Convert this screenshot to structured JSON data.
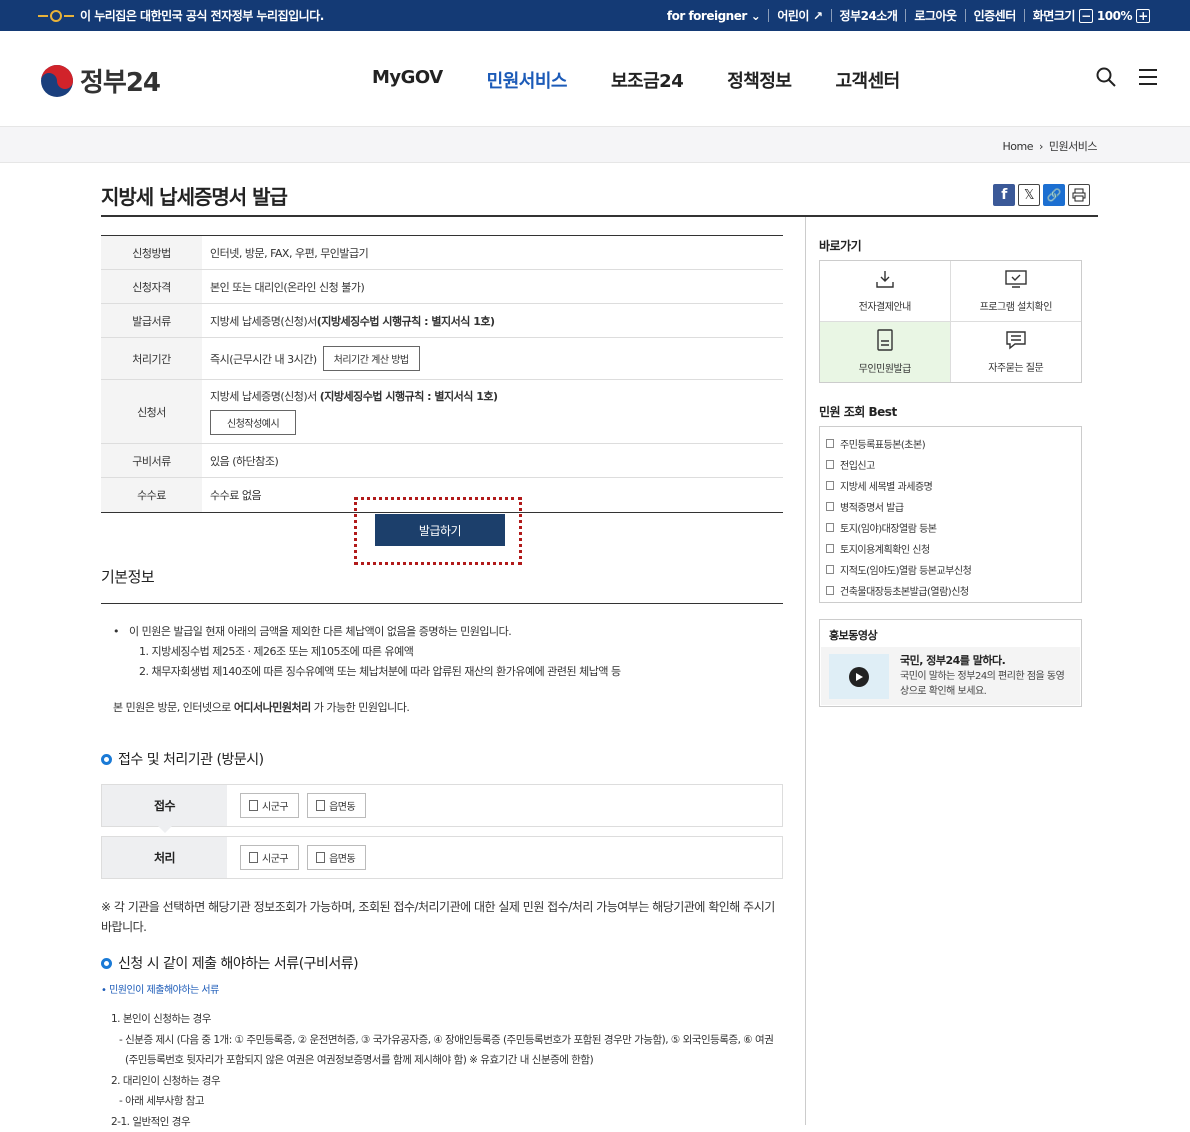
{
  "govbar": {
    "notice": "이 누리집은 대한민국 공식 전자정부 누리집입니다.",
    "links": [
      "for foreigner",
      "어린이",
      "정부24소개",
      "로그아웃",
      "인증센터"
    ],
    "zoom_label": "화면크기",
    "zoom_value": "100%"
  },
  "header": {
    "logo_text": "정부24",
    "nav": [
      "MyGOV",
      "민원서비스",
      "보조금24",
      "정책정보",
      "고객센터"
    ],
    "active_nav": "민원서비스"
  },
  "breadcrumb": [
    "Home",
    "민원서비스"
  ],
  "page": {
    "title": "지방세 납세증명서 발급",
    "info_rows": [
      {
        "label": "신청방법",
        "value": "인터넷, 방문, FAX, 우편, 무인발급기"
      },
      {
        "label": "신청자격",
        "value": "본인 또는 대리인(온라인 신청 불가)"
      },
      {
        "label": "발급서류",
        "value": "지방세 납세증명(신청)서 ",
        "bold": "(지방세징수법 시행규칙 : 별지서식 1호)"
      },
      {
        "label": "처리기간",
        "value": "즉시(근무시간 내 3시간)",
        "button": "처리기간 계산 방법"
      },
      {
        "label": "신청서",
        "value": "지방세 납세증명(신청)서 ",
        "bold": "(지방세징수법 시행규칙 : 별지서식 1호)",
        "button": "신청작성예시"
      },
      {
        "label": "구비서류",
        "value": "있음 (하단참조)"
      },
      {
        "label": "수수료",
        "value": "수수료 없음"
      }
    ],
    "issue_button": "발급하기",
    "basic_title": "기본정보",
    "basic_bullet": "이 민원은 발급일 현재 아래의 금액을 제외한 다른 체납액이 없음을 증명하는 민원입니다.",
    "basic_sub": [
      "1. 지방세징수법 제25조 · 제26조 또는 제105조에 따른 유예액",
      "2. 채무자회생법 제140조에 따른 징수유예액 또는 체납처분에 따라 압류된 재산의 환가유예에 관련된 체납액 등"
    ],
    "basic_note_pre": "본 민원은 방문, 인터넷으로 ",
    "basic_note_bold": "어디서나민원처리",
    "basic_note_post": " 가 가능한 민원입니다.",
    "agency_title": "접수 및 처리기관 (방문시)",
    "agency_rows": [
      {
        "label": "접수",
        "options": [
          "시군구",
          "읍면동"
        ]
      },
      {
        "label": "처리",
        "options": [
          "시군구",
          "읍면동"
        ]
      }
    ],
    "agency_notice": "※ 각 기관을 선택하면 해당기관 정보조회가 가능하며, 조회된 접수/처리기관에 대한 실제 민원 접수/처리 가능여부는 해당기관에 확인해 주시기 바랍니다.",
    "docs_title": "신청 시 같이 제출 해야하는 서류(구비서류)",
    "docs_subhead": "• 민원인이 제출해야하는 서류",
    "docs_lines": [
      "1. 본인이 신청하는 경우",
      "- 신분증 제시 (다음 중 1개: ① 주민등록증, ② 운전면허증, ③ 국가유공자증, ④ 장애인등록증 (주민등록번호가 포함된 경우만 가능함), ⑤ 외국인등록증, ⑥ 여권",
      "(주민등록번호 뒷자리가 포함되지 않은 여권은 여권정보증명서를 함께 제시해야 함) ※ 유효기간 내 신분증에 한함)",
      "2. 대리인이 신청하는 경우",
      "- 아래 세부사항 참고",
      "2-1. 일반적인 경우"
    ]
  },
  "sidebar": {
    "quick_title": "바로가기",
    "quick_items": [
      "전자결제안내",
      "프로그램 설치확인",
      "무인민원발급",
      "자주묻는 질문"
    ],
    "best_title": "민원 조회 Best",
    "best_items": [
      "주민등록표등본(초본)",
      "전입신고",
      "지방세 세목별 과세증명",
      "병적증명서 발급",
      "토지(임야)대장열람 등본",
      "토지이용계획확인 신청",
      "지적도(임야도)열람 등본교부신청",
      "건축물대장등초본발급(열람)신청"
    ],
    "promo_title": "홍보동영상",
    "promo_video_title": "국민, 정부24를 말하다.",
    "promo_video_desc": "국민이 말하는 정부24의 편리한 점을 동영상으로 확인해 보세요."
  },
  "colors": {
    "govbar": "#143a75",
    "nav_active": "#1c5bb8",
    "issue_button": "#1c3f6b",
    "highlight_border": "#b11a1a",
    "quick_highlight": "#e9f6e4"
  }
}
